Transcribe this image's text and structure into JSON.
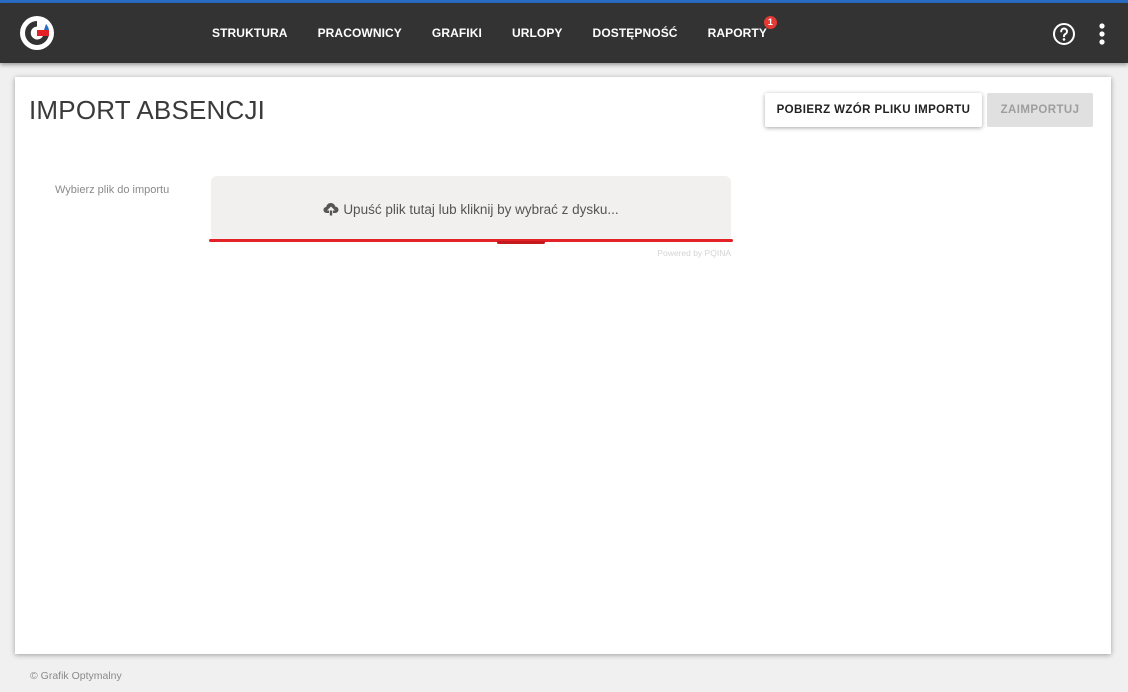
{
  "header": {
    "nav": [
      {
        "label": "STRUKTURA"
      },
      {
        "label": "PRACOWNICY"
      },
      {
        "label": "GRAFIKI"
      },
      {
        "label": "URLOPY"
      },
      {
        "label": "DOSTĘPNOŚĆ"
      },
      {
        "label": "RAPORTY",
        "badge": "1"
      }
    ]
  },
  "page": {
    "title": "IMPORT ABSENCJI",
    "download_template_label": "POBIERZ WZÓR PLIKU IMPORTU",
    "import_label": "ZAIMPORTUJ",
    "file_label": "Wybierz plik do importu",
    "dropzone_text": "Upuść plik tutaj lub kliknij by wybrać z dysku...",
    "powered_by": "Powered by PQINA"
  },
  "footer": {
    "copyright": "© Grafik Optymalny"
  },
  "colors": {
    "navbar": "#333333",
    "accent_red": "#e42127",
    "accent_blue": "#2b6cc4"
  }
}
